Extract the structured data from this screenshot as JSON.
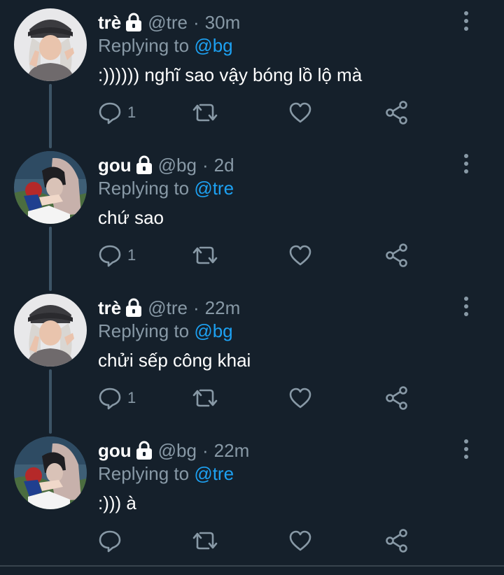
{
  "colors": {
    "background": "#15202b",
    "text_primary": "#ffffff",
    "text_secondary": "#8899a6",
    "mention": "#1da1f2",
    "thread_line": "#3d5466"
  },
  "icons": {
    "more": "more-vertical-icon",
    "reply": "reply-icon",
    "retweet": "retweet-icon",
    "like": "heart-icon",
    "share": "share-icon",
    "lock": "lock-icon"
  },
  "replying_prefix": "Replying to",
  "tweets": [
    {
      "name": "trè",
      "handle": "@tre",
      "separator": "·",
      "time": "30m",
      "replying_to": "@bg",
      "text": ":)))))) nghĩ sao vậy bóng lồ lộ mà",
      "reply_count": "1",
      "protected": true
    },
    {
      "name": "gou",
      "handle": "@bg",
      "separator": "·",
      "time": "2d",
      "replying_to": "@tre",
      "text": "chứ sao",
      "reply_count": "1",
      "protected": true
    },
    {
      "name": "trè",
      "handle": "@tre",
      "separator": "·",
      "time": "22m",
      "replying_to": "@bg",
      "text": "chửi sếp công khai",
      "reply_count": "1",
      "protected": true
    },
    {
      "name": "gou",
      "handle": "@bg",
      "separator": "·",
      "time": "22m",
      "replying_to": "@tre",
      "text": ":))) à",
      "reply_count": "",
      "protected": true
    }
  ]
}
